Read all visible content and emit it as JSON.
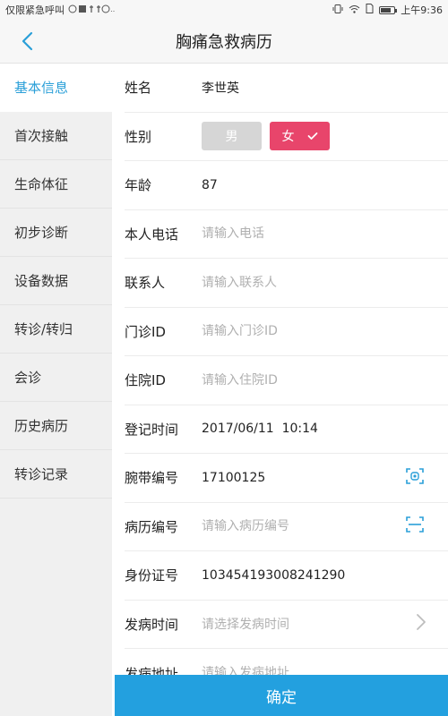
{
  "status": {
    "left_text": "仅限紧急呼叫",
    "time": "上午9:36"
  },
  "header": {
    "title": "胸痛急救病历"
  },
  "sidebar": {
    "items": [
      {
        "label": "基本信息",
        "active": true
      },
      {
        "label": "首次接触"
      },
      {
        "label": "生命体征"
      },
      {
        "label": "初步诊断"
      },
      {
        "label": "设备数据"
      },
      {
        "label": "转诊/转归"
      },
      {
        "label": "会诊"
      },
      {
        "label": "历史病历"
      },
      {
        "label": "转诊记录"
      }
    ]
  },
  "form": {
    "name": {
      "label": "姓名",
      "value": "李世英"
    },
    "gender": {
      "label": "性别",
      "male": "男",
      "female": "女",
      "selected": "女"
    },
    "age": {
      "label": "年龄",
      "value": "87"
    },
    "phone": {
      "label": "本人电话",
      "placeholder": "请输入电话"
    },
    "contact": {
      "label": "联系人",
      "placeholder": "请输入联系人"
    },
    "outpatient_id": {
      "label": "门诊ID",
      "placeholder": "请输入门诊ID"
    },
    "inpatient_id": {
      "label": "住院ID",
      "placeholder": "请输入住院ID"
    },
    "reg_time": {
      "label": "登记时间",
      "value": "2017/06/11  10:14"
    },
    "wristband": {
      "label": "腕带编号",
      "value": "17100125"
    },
    "record_no": {
      "label": "病历编号",
      "placeholder": "请输入病历编号"
    },
    "id_card": {
      "label": "身份证号",
      "value": "103454193008241290"
    },
    "onset_time": {
      "label": "发病时间",
      "placeholder": "请选择发病时间"
    },
    "onset_address": {
      "label": "发病地址",
      "placeholder": "请输入发病地址"
    }
  },
  "confirm": {
    "label": "确定"
  },
  "colors": {
    "accent": "#23a0df",
    "female": "#e8456b",
    "male": "#d6d6d6",
    "active_text": "#2a9fd8"
  }
}
